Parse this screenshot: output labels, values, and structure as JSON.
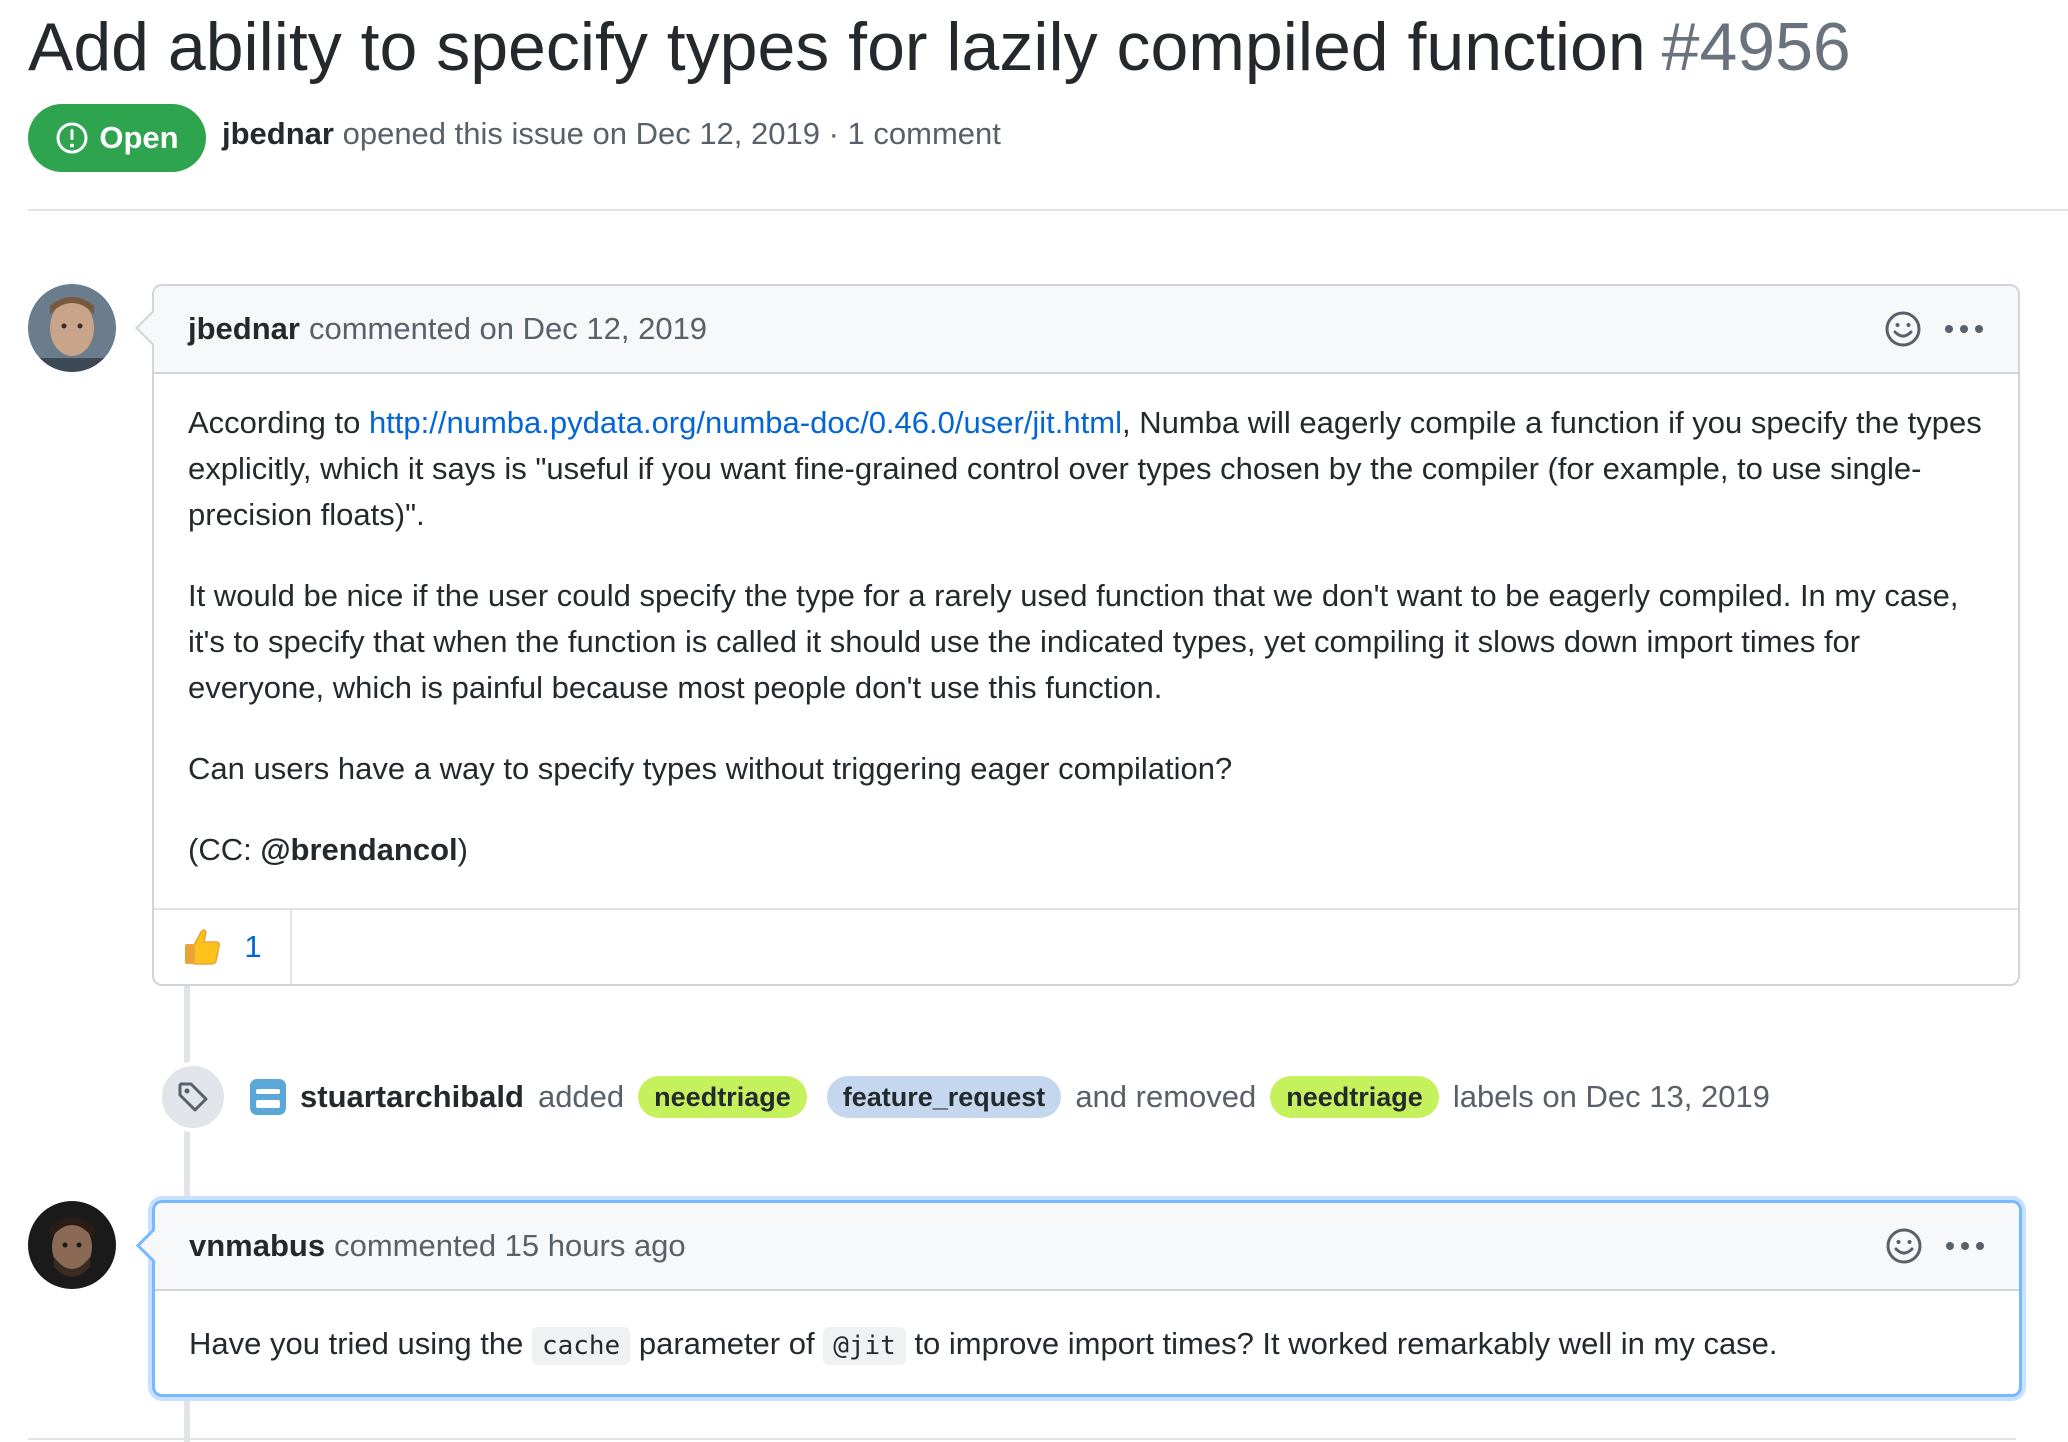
{
  "issue": {
    "title": "Add ability to specify types for lazily compiled function",
    "number": "#4956",
    "state": "Open",
    "author": "jbednar",
    "opened_text": "opened this issue on Dec 12, 2019 · 1 comment"
  },
  "comment1": {
    "author": "jbednar",
    "meta": "commented on Dec 12, 2019",
    "p1_before": "According to ",
    "p1_link": "http://numba.pydata.org/numba-doc/0.46.0/user/jit.html",
    "p1_after": ", Numba will eagerly compile a function if you specify the types explicitly, which it says is \"useful if you want fine-grained control over types chosen by the compiler (for example, to use single-precision floats)\".",
    "p2": "It would be nice if the user could specify the type for a rarely used function that we don't want to be eagerly compiled. In my case, it's to specify that when the function is called it should use the indicated types, yet compiling it slows down import times for everyone, which is painful because most people don't use this function.",
    "p3": "Can users have a way to specify types without triggering eager compilation?",
    "p4_before": "(CC: ",
    "p4_mention": "@brendancol",
    "p4_after": ")",
    "reaction_count": "1"
  },
  "event": {
    "actor": "stuartarchibald",
    "added": "added",
    "label1": "needtriage",
    "label2": "feature_request",
    "removed": "and removed",
    "label3": "needtriage",
    "suffix": "labels on Dec 13, 2019"
  },
  "comment2": {
    "author": "vnmabus",
    "meta": "commented 15 hours ago",
    "t1": "Have you tried using the ",
    "code1": "cache",
    "t2": " parameter of ",
    "code2": "@jit",
    "t3": " to improve import times? It worked remarkably well in my case."
  },
  "icons": [
    "issue-opened-icon",
    "smiley-icon",
    "kebab-icon",
    "thumbs-up-icon",
    "tag-icon",
    "bot-icon"
  ],
  "colors": {
    "open_green": "#2ea44f",
    "link_blue": "#0366d6",
    "label_green": "#c5f15c",
    "label_blue": "#c5d7ef",
    "focus_blue": "#79b8ff"
  }
}
